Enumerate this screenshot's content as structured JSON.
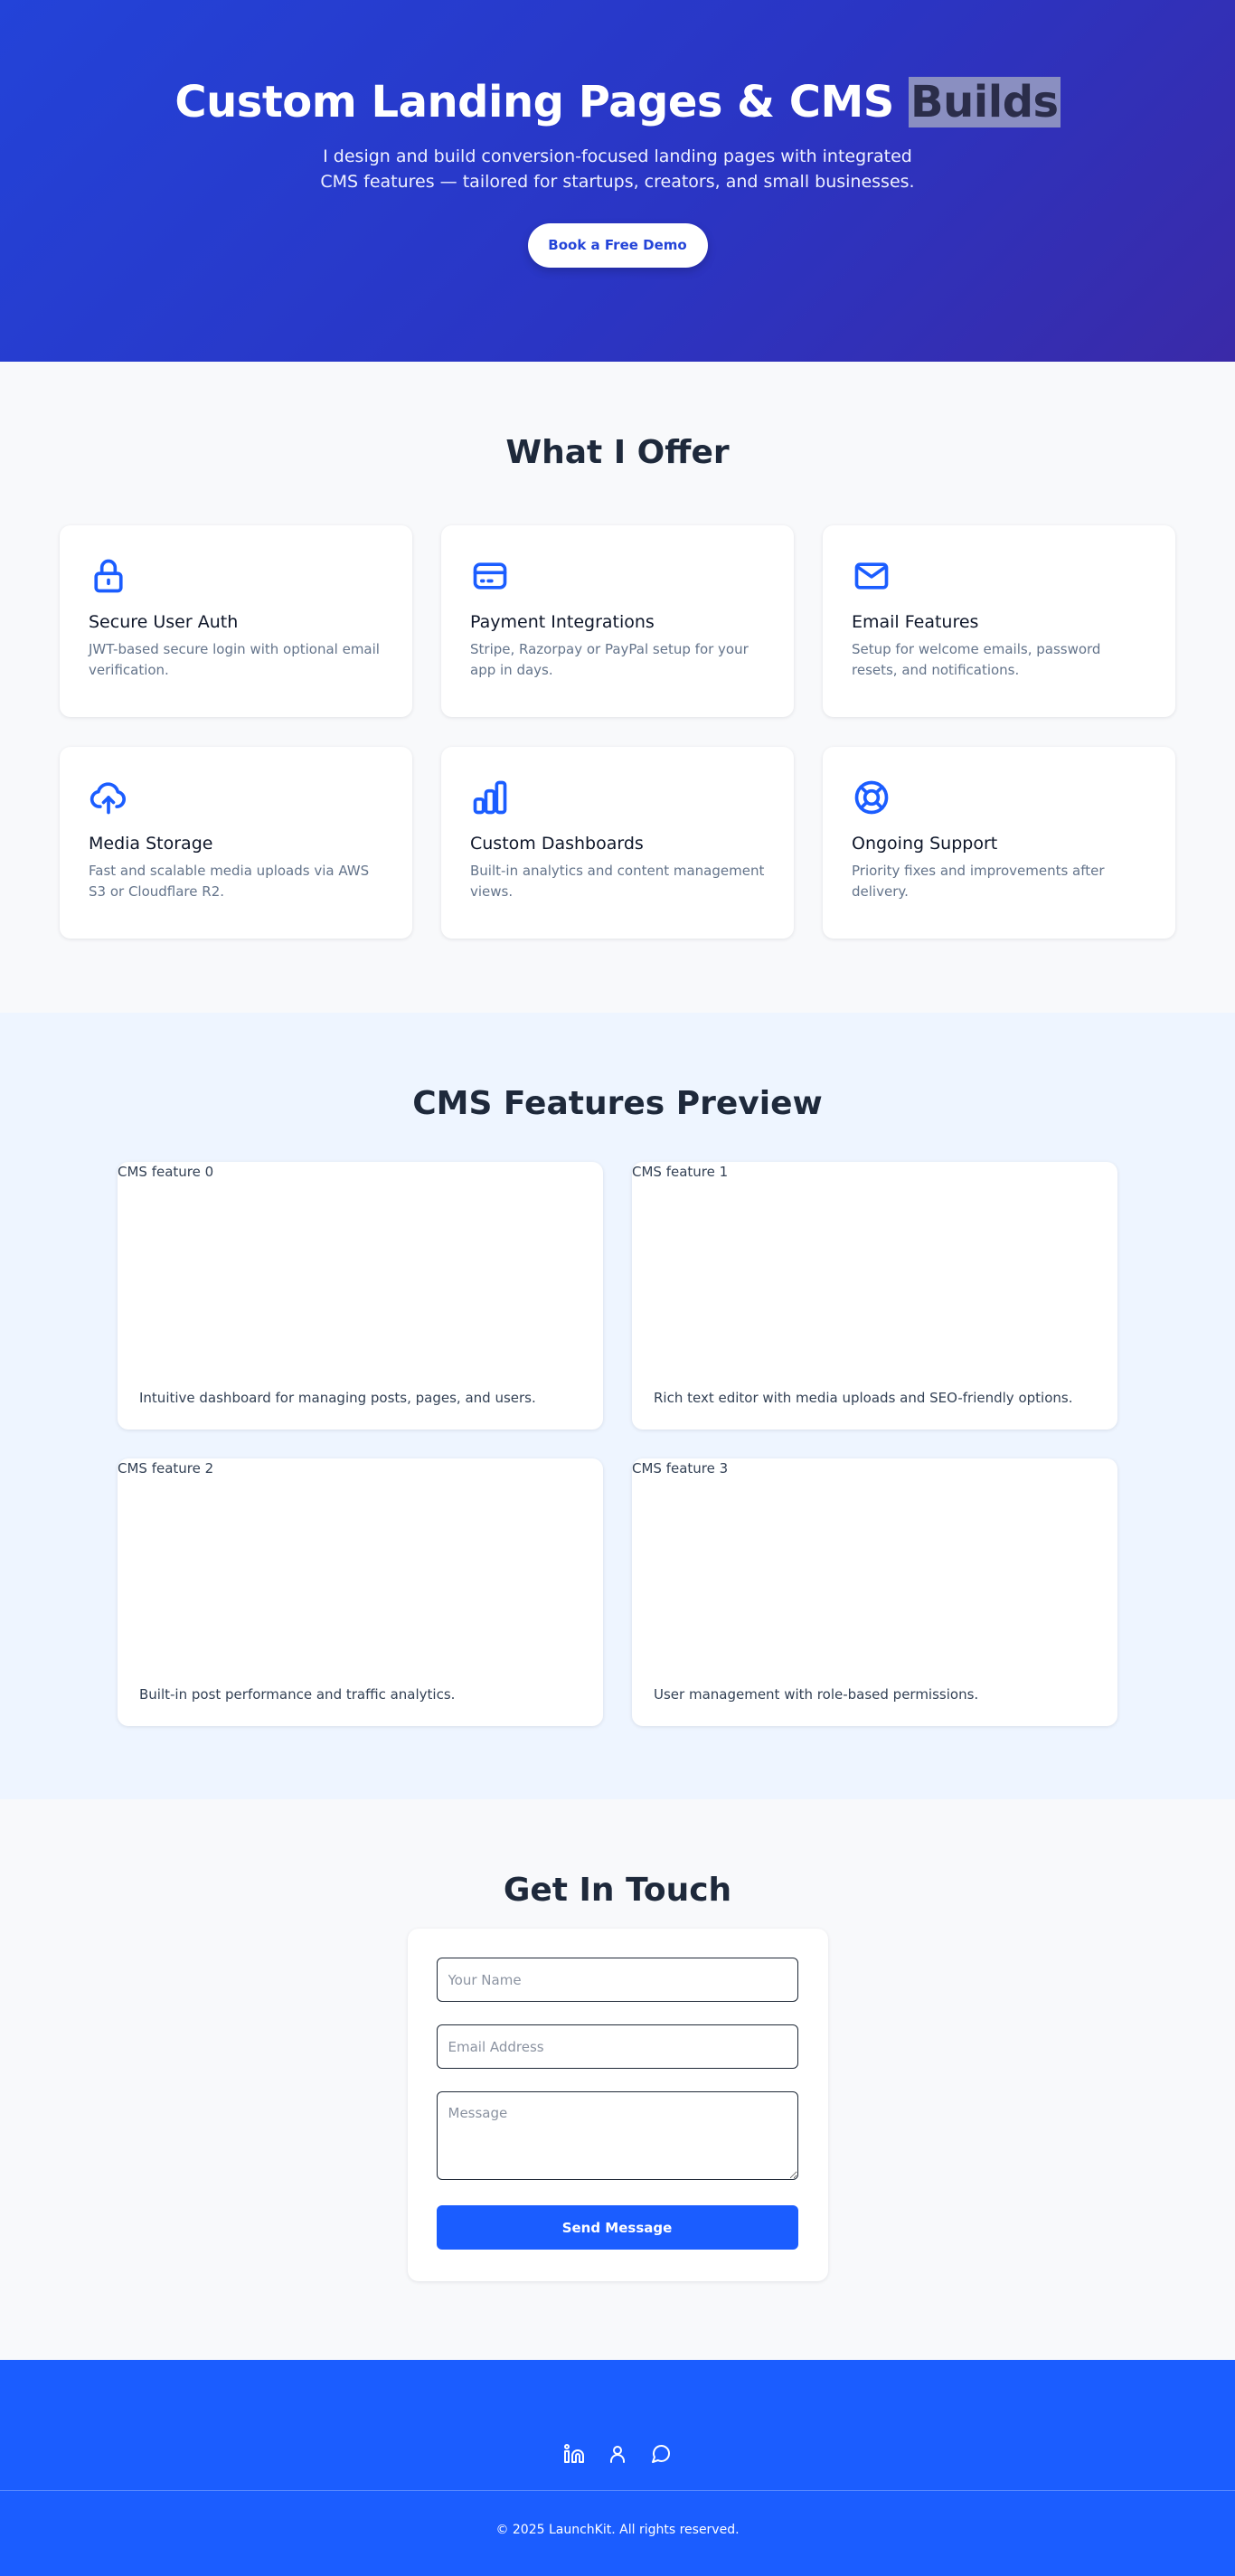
{
  "hero": {
    "title_main": "Custom Landing Pages & CMS",
    "title_highlight": "Builds",
    "subtitle": "I design and build conversion-focused landing pages with integrated CMS features — tailored for startups, creators, and small businesses.",
    "cta_label": "Book a Free Demo"
  },
  "offer": {
    "title": "What I Offer",
    "cards": [
      {
        "icon": "lock-icon",
        "title": "Secure User Auth",
        "desc": "JWT-based secure login with optional email verification."
      },
      {
        "icon": "credit-card-icon",
        "title": "Payment Integrations",
        "desc": "Stripe, Razorpay or PayPal setup for your app in days."
      },
      {
        "icon": "mail-icon",
        "title": "Email Features",
        "desc": "Setup for welcome emails, password resets, and notifications."
      },
      {
        "icon": "cloud-upload-icon",
        "title": "Media Storage",
        "desc": "Fast and scalable media uploads via AWS S3 or Cloudflare R2."
      },
      {
        "icon": "bar-chart-icon",
        "title": "Custom Dashboards",
        "desc": "Built-in analytics and content management views."
      },
      {
        "icon": "lifebuoy-icon",
        "title": "Ongoing Support",
        "desc": "Priority fixes and improvements after delivery."
      }
    ]
  },
  "features": {
    "title": "CMS Features Preview",
    "items": [
      {
        "alt": "CMS feature 0",
        "desc": "Intuitive dashboard for managing posts, pages, and users."
      },
      {
        "alt": "CMS feature 1",
        "desc": "Rich text editor with media uploads and SEO-friendly options."
      },
      {
        "alt": "CMS feature 2",
        "desc": "Built-in post performance and traffic analytics."
      },
      {
        "alt": "CMS feature 3",
        "desc": "User management with role-based permissions."
      }
    ]
  },
  "contact": {
    "title": "Get In Touch",
    "name_placeholder": "Your Name",
    "email_placeholder": "Email Address",
    "message_placeholder": "Message",
    "submit_label": "Send Message"
  },
  "footer": {
    "social": [
      "linkedin-icon",
      "user-icon",
      "chat-bubble-icon"
    ],
    "copyright": "© 2025 LaunchKit. All rights reserved."
  },
  "colors": {
    "primary": "#1b5dff",
    "hero_gradient_start": "#2343d8",
    "hero_gradient_end": "#3a2aa8",
    "icon_blue": "#1b5dff"
  }
}
